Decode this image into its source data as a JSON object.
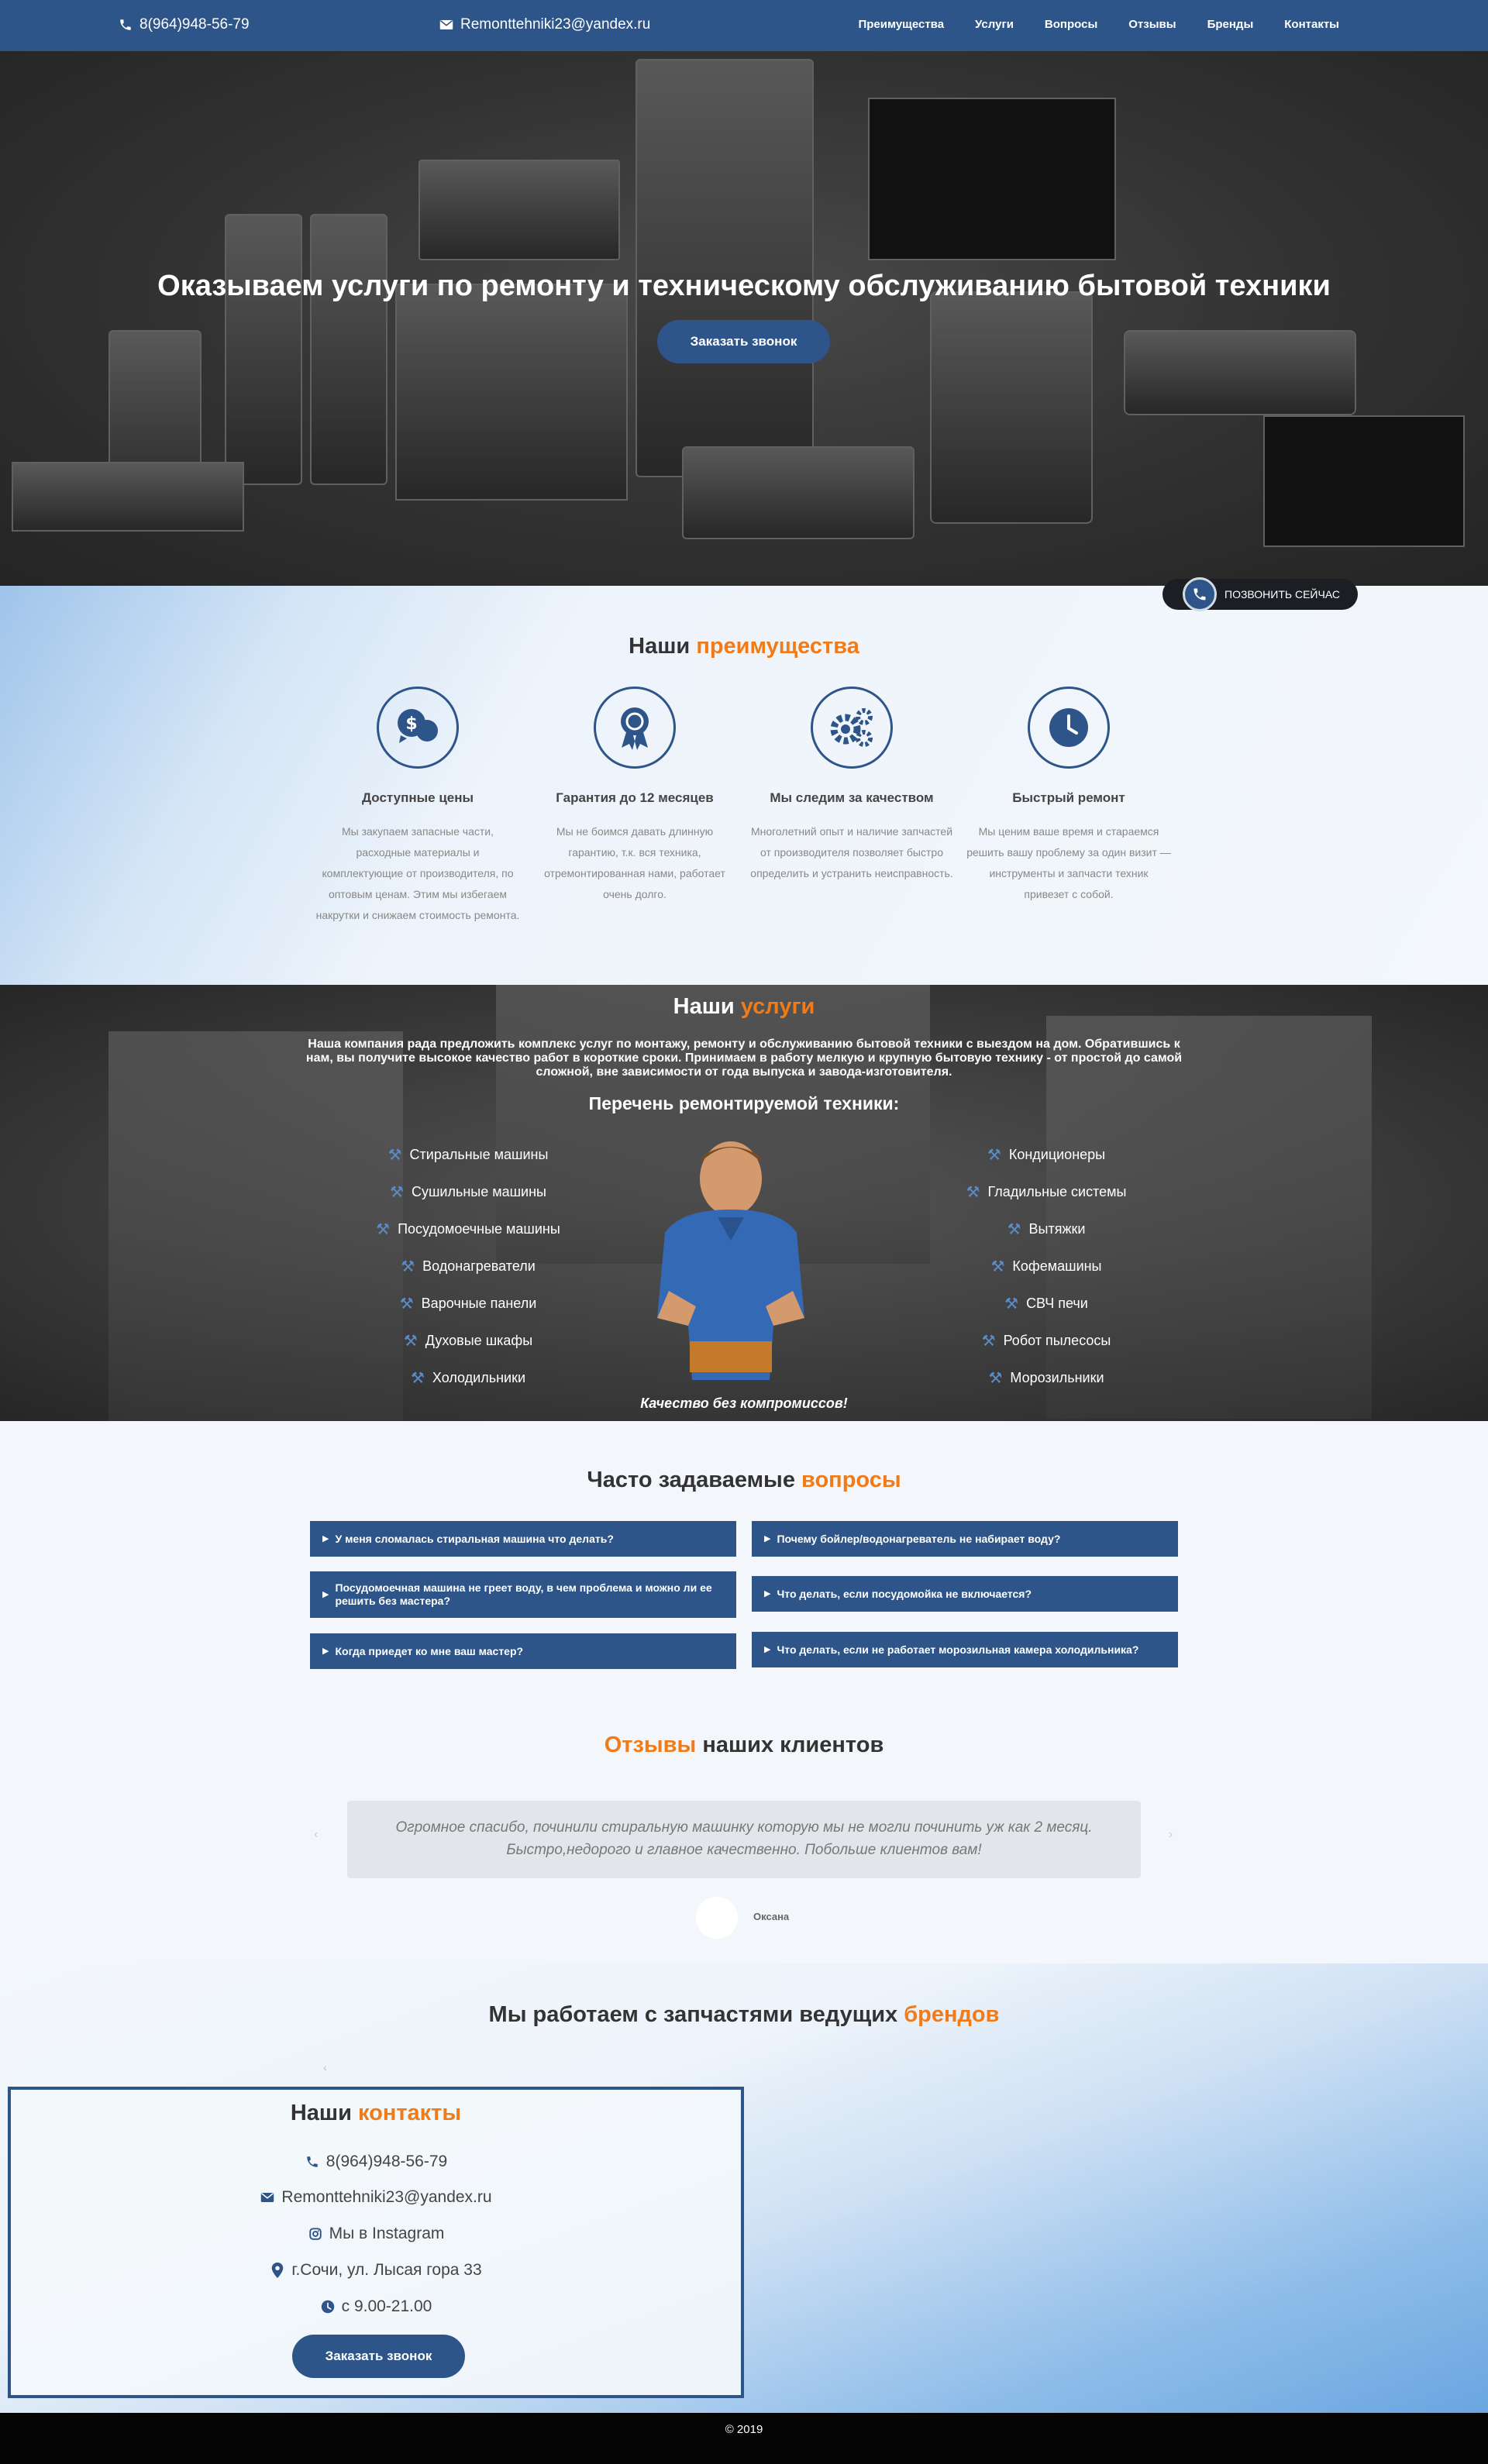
{
  "header": {
    "phone": "8(964)948-56-79",
    "email": "Remonttehniki23@yandex.ru",
    "nav": [
      "Преимущества",
      "Услуги",
      "Вопросы",
      "Отзывы",
      "Бренды",
      "Контакты"
    ]
  },
  "hero": {
    "title": "Оказываем услуги по ремонту и техническому обслуживанию бытовой техники",
    "cta": "Заказать звонок"
  },
  "call_now": "ПОЗВОНИТЬ СЕЙЧАС",
  "advantages": {
    "title_plain": "Наши",
    "title_accent": "преимущества",
    "items": [
      {
        "icon": "price-chat-icon",
        "title": "Доступные цены",
        "text": "Мы закупаем запасные части, расходные материалы и комплектующие от производителя, по оптовым ценам. Этим мы избегаем накрутки и снижаем стоимость ремонта."
      },
      {
        "icon": "award-medal-icon",
        "title": "Гарантия до 12 месяцев",
        "text": "Мы не боимся давать длинную гарантию, т.к. вся техника, отремонтированная нами, работает очень долго."
      },
      {
        "icon": "gears-icon",
        "title": "Мы следим за качеством",
        "text": "Многолетний опыт и наличие запчастей от производителя позволяет быстро определить и устранить неисправность."
      },
      {
        "icon": "clock-icon",
        "title": "Быстрый ремонт",
        "text": "Мы ценим ваше время и стараемся решить вашу проблему за один визит — инструменты и запчасти техник привезет с собой."
      }
    ]
  },
  "services": {
    "title_plain": "Наши",
    "title_accent": "услуги",
    "intro": "Наша компания рада предложить комплекс услуг по монтажу, ремонту и обслуживанию бытовой техники с выездом на дом. Обратившись к нам, вы получите высокое качество работ в короткие сроки. Принимаем в работу мелкую и крупную бытовую технику - от простой до самой сложной, вне зависимости от года выпуска и завода-изготовителя.",
    "list_title": "Перечень ремонтируемой техники:",
    "left": [
      "Стиральные машины",
      "Сушильные машины",
      "Посудомоечные машины",
      "Водонагреватели",
      "Варочные панели",
      "Духовые шкафы",
      "Холодильники"
    ],
    "right": [
      "Кондиционеры",
      "Гладильные системы",
      "Вытяжки",
      "Кофемашины",
      "СВЧ печи",
      "Робот пылесосы",
      "Морозильники"
    ],
    "motto": "Качество без компромиссов!"
  },
  "faq": {
    "title_plain": "Часто задаваемые",
    "title_accent": "вопросы",
    "left": [
      "У меня сломалась стиральная машина что делать?",
      "Посудомоечная машина не греет воду, в чем проблема и можно ли ее решить без мастера?",
      "Когда приедет ко мне ваш мастер?"
    ],
    "right": [
      "Почему бойлер/водонагреватель не набирает воду?",
      "Что делать, если посудомойка не включается?",
      "Что делать, если не работает морозильная камера холодильника?"
    ]
  },
  "reviews": {
    "title_accent": "Отзывы",
    "title_plain": "наших клиентов",
    "text_line1": "Огромное спасибо, починили стиральную машинку которую мы не могли починить уж как 2 месяц.",
    "text_line2": "Быстро,недорого и главное качественно. Побольше клиентов вам!",
    "author": "Оксана"
  },
  "brands": {
    "title_plain": "Мы работаем с запчастями ведущих",
    "title_accent": "брендов"
  },
  "contacts": {
    "title_plain": "Наши",
    "title_accent": "контакты",
    "phone": "8(964)948-56-79",
    "email": "Remonttehniki23@yandex.ru",
    "instagram": "Мы в Instagram",
    "address": "г.Сочи, ул. Лысая гора 33",
    "hours": "с 9.00-21.00",
    "cta": "Заказать звонок"
  },
  "footer": {
    "copyright": "© 2019"
  },
  "colors": {
    "primary": "#2d5589",
    "accent": "#f07b18",
    "footer": "#050505"
  }
}
